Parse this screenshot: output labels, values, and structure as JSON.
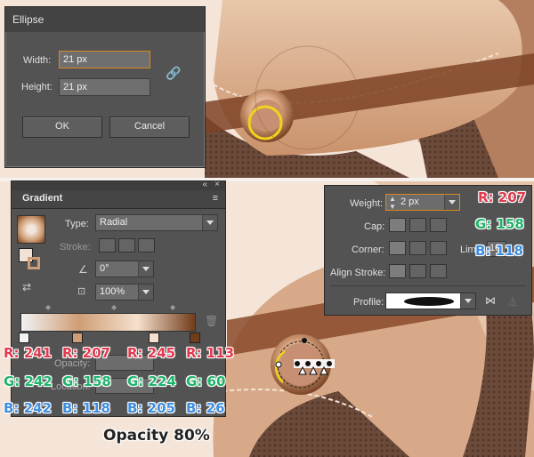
{
  "ellipse_dialog": {
    "title": "Ellipse",
    "width_label": "Width:",
    "width_value": "21 px",
    "height_label": "Height:",
    "height_value": "21 px",
    "ok_label": "OK",
    "cancel_label": "Cancel"
  },
  "gradient_panel": {
    "tab_label": "Gradient",
    "type_label": "Type:",
    "type_value": "Radial",
    "stroke_label": "Stroke:",
    "angle_value": "0°",
    "aspect_value": "100%",
    "opacity_label": "Opacity:",
    "location_label": "Location:"
  },
  "stroke_panel": {
    "weight_label": "Weight:",
    "weight_value": "2 px",
    "cap_label": "Cap:",
    "corner_label": "Corner:",
    "limit_label": "Limit:",
    "limit_value": "10",
    "align_label": "Align Stroke:",
    "profile_label": "Profile:"
  },
  "stroke_color": {
    "r": "R: 207",
    "g": "G: 158",
    "b": "B: 118"
  },
  "stops": [
    {
      "r": "R: 241",
      "g": "G: 242",
      "b": "B: 242",
      "color": "#f1f2f2"
    },
    {
      "r": "R: 207",
      "g": "G: 158",
      "b": "B: 118",
      "color": "#cf9e76"
    },
    {
      "r": "R: 245",
      "g": "G: 224",
      "b": "B: 205",
      "color": "#f5e0cd"
    },
    {
      "r": "R: 113",
      "g": "G: 60",
      "b": "B: 26",
      "color": "#713c1a"
    }
  ],
  "opacity_note": "Opacity 80%"
}
